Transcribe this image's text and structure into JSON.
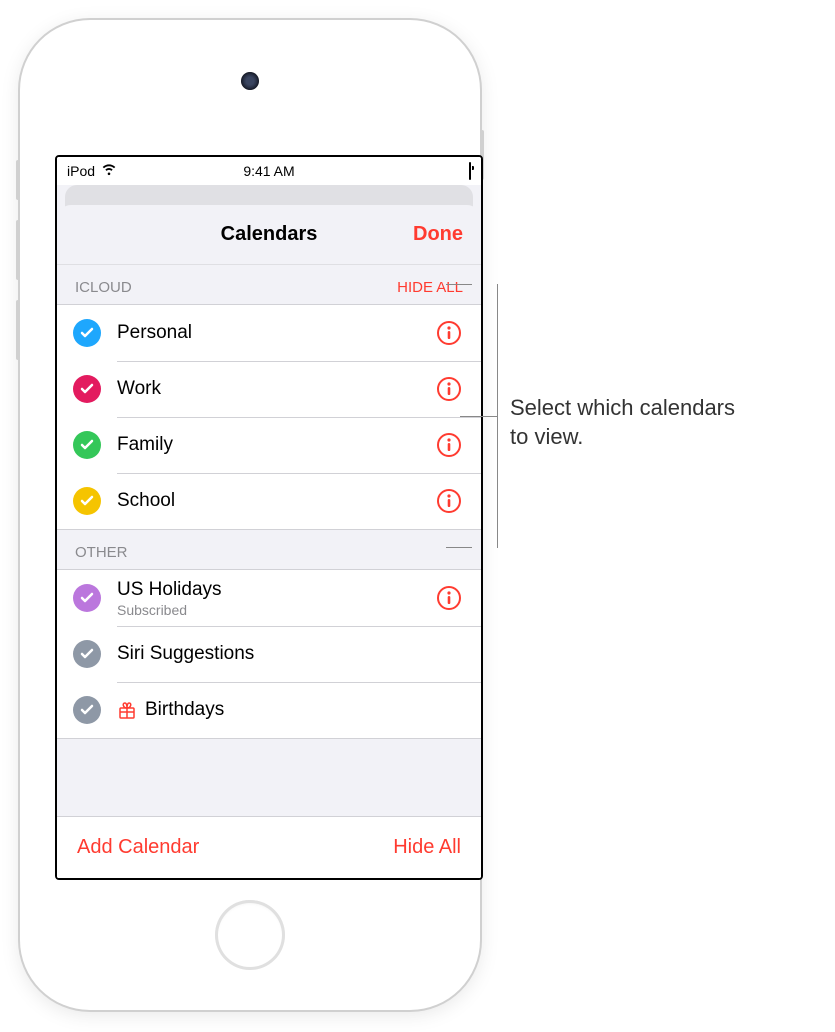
{
  "status_bar": {
    "carrier": "iPod",
    "time": "9:41 AM"
  },
  "sheet": {
    "title": "Calendars",
    "done_label": "Done"
  },
  "sections": [
    {
      "header": "ICLOUD",
      "action": "HIDE ALL",
      "items": [
        {
          "name": "Personal",
          "color": "#1ea7fd",
          "has_info": true
        },
        {
          "name": "Work",
          "color": "#e31b5f",
          "has_info": true
        },
        {
          "name": "Family",
          "color": "#34c759",
          "has_info": true
        },
        {
          "name": "School",
          "color": "#f5c400",
          "has_info": true
        }
      ]
    },
    {
      "header": "OTHER",
      "action": "",
      "items": [
        {
          "name": "US Holidays",
          "subtitle": "Subscribed",
          "color": "#bb77dd",
          "has_info": true
        },
        {
          "name": "Siri Suggestions",
          "color": "#8e98a6",
          "has_info": false
        },
        {
          "name": "Birthdays",
          "color": "#8e98a6",
          "has_info": false,
          "icon": "gift"
        }
      ]
    }
  ],
  "bottom": {
    "add_label": "Add Calendar",
    "hide_label": "Hide All"
  },
  "callout": {
    "text_line1": "Select which calendars",
    "text_line2": "to view."
  },
  "colors": {
    "accent": "#ff3b30"
  }
}
